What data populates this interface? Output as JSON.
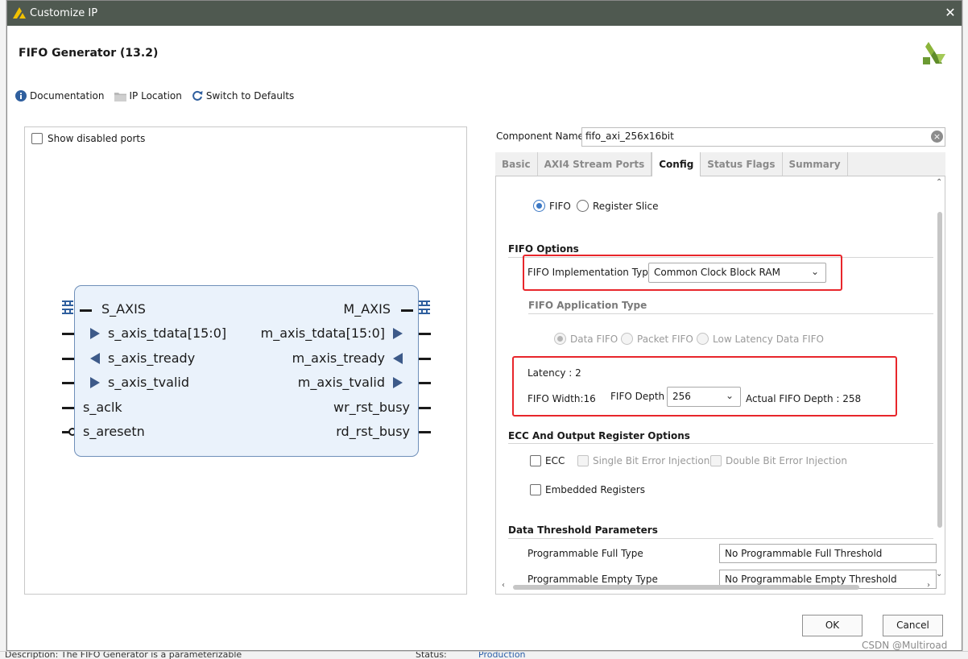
{
  "window": {
    "title": "Customize IP",
    "close_glyph": "✕"
  },
  "header": {
    "title": "FIFO Generator (13.2)"
  },
  "toolbar": {
    "documentation": "Documentation",
    "ip_location": "IP Location",
    "switch_defaults": "Switch to Defaults"
  },
  "preview": {
    "show_disabled_ports": "Show disabled ports",
    "block": {
      "left_bus": "S_AXIS",
      "right_bus": "M_AXIS",
      "left_ports": [
        "s_axis_tdata[15:0]",
        "s_axis_tready",
        "s_axis_tvalid",
        "s_aclk",
        "s_aresetn"
      ],
      "right_ports": [
        "m_axis_tdata[15:0]",
        "m_axis_tready",
        "m_axis_tvalid",
        "wr_rst_busy",
        "rd_rst_busy"
      ]
    }
  },
  "component": {
    "label": "Component Name",
    "value": "fifo_axi_256x16bit"
  },
  "tabs": [
    {
      "label": "Basic"
    },
    {
      "label": "AXI4 Stream Ports"
    },
    {
      "label": "Config"
    },
    {
      "label": "Status Flags"
    },
    {
      "label": "Summary"
    }
  ],
  "config": {
    "mode": {
      "fifo": "FIFO",
      "register_slice": "Register Slice"
    },
    "fifo_options": {
      "title": "FIFO Options",
      "impl_type_label": "FIFO Implementation Type",
      "impl_type_value": "Common Clock Block RAM",
      "app_type_title": "FIFO Application Type",
      "app_types": [
        "Data FIFO",
        "Packet FIFO",
        "Low Latency Data FIFO"
      ],
      "latency": "Latency : 2",
      "width": "FIFO Width:16",
      "depth_label": "FIFO Depth",
      "depth_value": "256",
      "actual_depth": "Actual FIFO Depth : 258"
    },
    "ecc": {
      "title": "ECC And Output Register Options",
      "ecc": "ECC",
      "single_bit": "Single Bit Error Injection",
      "double_bit": "Double Bit Error Injection",
      "embedded": "Embedded Registers"
    },
    "threshold": {
      "title": "Data Threshold Parameters",
      "full_label": "Programmable Full Type",
      "full_value": "No Programmable Full Threshold",
      "empty_label": "Programmable Empty Type",
      "empty_value": "No Programmable Empty Threshold"
    }
  },
  "footer": {
    "ok": "OK",
    "cancel": "Cancel"
  },
  "watermark": "CSDN @Multiroad",
  "background": {
    "status_label": "Status:",
    "status_value": "Production",
    "description": "Description:   The FIFO Generator is a parameterizable"
  },
  "colors": {
    "titlebar": "#4f5950",
    "accent": "#3b78c4",
    "highlight": "#e8262b",
    "block_fill": "#eaf2fb"
  }
}
